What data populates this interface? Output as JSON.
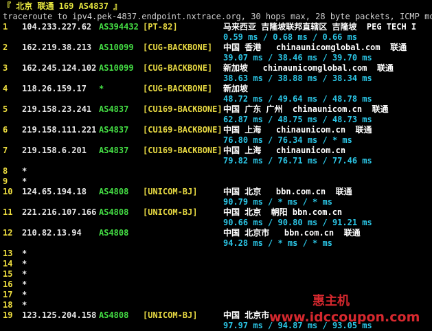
{
  "header": {
    "title": "『 北京 联通 169 AS4837 』",
    "info": "traceroute to ipv4.pek-4837.endpoint.nxtrace.org, 30 hops max, 28 byte packets, ICMP mode"
  },
  "hops": [
    {
      "n": "1",
      "ip": "104.233.227.62",
      "asn": "AS394432",
      "tag": "[PT-82]",
      "geo": "马来西亚 吉隆坡联邦直辖区 吉隆坡  PEG TECH I",
      "lat": "0.59 ms / 0.68 ms / 0.66 ms"
    },
    {
      "n": "2",
      "ip": "162.219.38.213",
      "asn": "AS10099",
      "tag": "[CUG-BACKBONE]",
      "geo": "中国 香港   chinaunicomglobal.com  联通",
      "lat": "39.07 ms / 38.46 ms / 39.70 ms"
    },
    {
      "n": "3",
      "ip": "162.245.124.102",
      "asn": "AS10099",
      "tag": "[CUG-BACKBONE]",
      "geo": "新加坡   chinaunicomglobal.com  联通",
      "lat": "38.63 ms / 38.88 ms / 38.34 ms"
    },
    {
      "n": "4",
      "ip": "118.26.159.17",
      "asn": "*",
      "tag": "[CUG-BACKBONE]",
      "geo": "新加坡",
      "lat": "48.72 ms / 49.64 ms / 48.78 ms"
    },
    {
      "n": "5",
      "ip": "219.158.23.241",
      "asn": "AS4837",
      "tag": "[CU169-BACKBONE]",
      "geo": "中国 广东 广州  chinaunicom.cn  联通",
      "lat": "62.87 ms / 48.75 ms / 48.73 ms"
    },
    {
      "n": "6",
      "ip": "219.158.111.221",
      "asn": "AS4837",
      "tag": "[CU169-BACKBONE]",
      "geo": "中国 上海   chinaunicom.cn  联通",
      "lat": "76.80 ms / 76.34 ms / * ms"
    },
    {
      "n": "7",
      "ip": "219.158.6.201",
      "asn": "AS4837",
      "tag": "[CU169-BACKBONE]",
      "geo": "中国 上海   chinaunicom.cn",
      "lat": "79.82 ms / 76.71 ms / 77.46 ms"
    },
    {
      "n": "8",
      "ip": "*",
      "asn": "",
      "tag": "",
      "geo": "",
      "lat": ""
    },
    {
      "n": "9",
      "ip": "*",
      "asn": "",
      "tag": "",
      "geo": "",
      "lat": ""
    },
    {
      "n": "10",
      "ip": "124.65.194.18",
      "asn": "AS4808",
      "tag": "[UNICOM-BJ]",
      "geo": "中国 北京   bbn.com.cn  联通",
      "lat": "90.79 ms / * ms / * ms"
    },
    {
      "n": "11",
      "ip": "221.216.107.166",
      "asn": "AS4808",
      "tag": "[UNICOM-BJ]",
      "geo": "中国 北京  朝阳 bbn.com.cn",
      "lat": "90.66 ms / 90.80 ms / 91.21 ms"
    },
    {
      "n": "12",
      "ip": "210.82.13.94",
      "asn": "AS4808",
      "tag": "",
      "geo": "中国 北京市   bbn.com.cn  联通",
      "lat": "94.28 ms / * ms / * ms"
    },
    {
      "n": "13",
      "ip": "*",
      "asn": "",
      "tag": "",
      "geo": "",
      "lat": ""
    },
    {
      "n": "14",
      "ip": "*",
      "asn": "",
      "tag": "",
      "geo": "",
      "lat": ""
    },
    {
      "n": "15",
      "ip": "*",
      "asn": "",
      "tag": "",
      "geo": "",
      "lat": ""
    },
    {
      "n": "16",
      "ip": "*",
      "asn": "",
      "tag": "",
      "geo": "",
      "lat": ""
    },
    {
      "n": "17",
      "ip": "*",
      "asn": "",
      "tag": "",
      "geo": "",
      "lat": ""
    },
    {
      "n": "18",
      "ip": "*",
      "asn": "",
      "tag": "",
      "geo": "",
      "lat": ""
    },
    {
      "n": "19",
      "ip": "123.125.204.158",
      "asn": "AS4808",
      "tag": "[UNICOM-BJ]",
      "geo": "中国 北京市",
      "lat": "97.97 ms / 94.87 ms / 93.05 ms"
    }
  ],
  "watermark": {
    "brand": "惠主机",
    "url": "www.idccoupon.com"
  },
  "colors": {
    "background": "#000000",
    "hop_number": "#f0e040",
    "asn": "#44dd44",
    "tag": "#e6d842",
    "latency": "#2bc4e4",
    "watermark": "#d6282e"
  }
}
